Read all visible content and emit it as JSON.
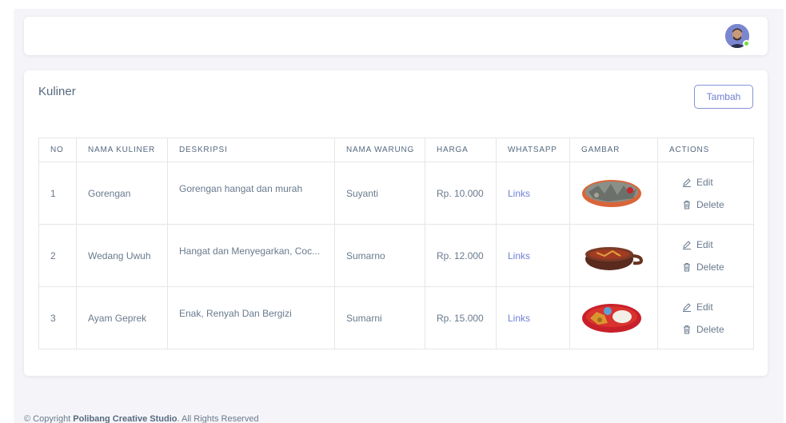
{
  "navbar": {
    "avatar": "user-avatar",
    "status": "online"
  },
  "card": {
    "title": "Kuliner",
    "add_label": "Tambah"
  },
  "table": {
    "headers": [
      "NO",
      "NAMA KULINER",
      "DESKRIPSI",
      "NAMA WARUNG",
      "HARGA",
      "WHATSAPP",
      "GAMBAR",
      "ACTIONS"
    ],
    "rows": [
      {
        "no": "1",
        "name": "Gorengan",
        "desc": "Gorengan hangat dan murah",
        "warung": "Suyanti",
        "price": "Rp. 10.000",
        "whatsapp": "Links",
        "image": "gorengan-food-image"
      },
      {
        "no": "2",
        "name": "Wedang Uwuh",
        "desc": "Hangat dan Menyegarkan, Coc...",
        "warung": "Sumarno",
        "price": "Rp. 12.000",
        "whatsapp": "Links",
        "image": "wedang-uwuh-food-image"
      },
      {
        "no": "3",
        "name": "Ayam Geprek",
        "desc": "Enak, Renyah Dan Bergizi",
        "warung": "Sumarni",
        "price": "Rp. 15.000",
        "whatsapp": "Links",
        "image": "ayam-geprek-food-image"
      }
    ],
    "edit_label": "Edit",
    "delete_label": "Delete"
  },
  "footer": {
    "prefix": "© Copyright ",
    "company": "Polibang Creative Studio",
    "suffix": ". All Rights Reserved"
  },
  "colors": {
    "accent": "#7080d8",
    "online": "#71dd37",
    "background": "#f5f5f9"
  }
}
